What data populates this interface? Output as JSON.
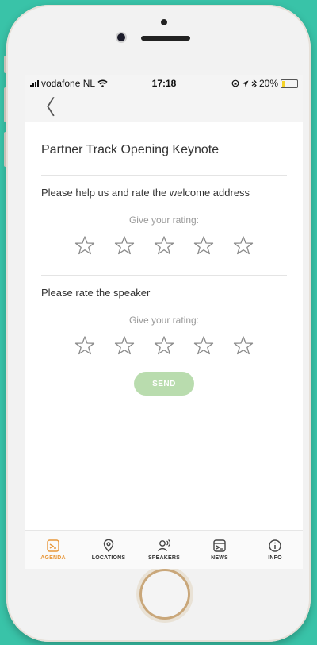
{
  "status": {
    "carrier": "vodafone NL",
    "time": "17:18",
    "battery": "20%",
    "battery_level": 0.2
  },
  "header": {
    "back_glyph": "〈"
  },
  "session": {
    "title": "Partner Track Opening Keynote"
  },
  "questions": [
    {
      "text": "Please help us and rate the welcome address",
      "hint": "Give your rating:",
      "rating": 0,
      "max": 5
    },
    {
      "text": "Please rate the speaker",
      "hint": "Give your rating:",
      "rating": 0,
      "max": 5
    }
  ],
  "send_label": "SEND",
  "tabs": [
    {
      "label": "AGENDA",
      "icon": "agenda-icon",
      "active": true
    },
    {
      "label": "LOCATIONS",
      "icon": "location-pin-icon",
      "active": false
    },
    {
      "label": "SPEAKERS",
      "icon": "speaker-icon",
      "active": false
    },
    {
      "label": "NEWS",
      "icon": "news-icon",
      "active": false
    },
    {
      "label": "INFO",
      "icon": "info-icon",
      "active": false
    }
  ],
  "colors": {
    "accent": "#e8973a",
    "send_disabled": "#b9dcae",
    "background": "#39c3a8"
  }
}
